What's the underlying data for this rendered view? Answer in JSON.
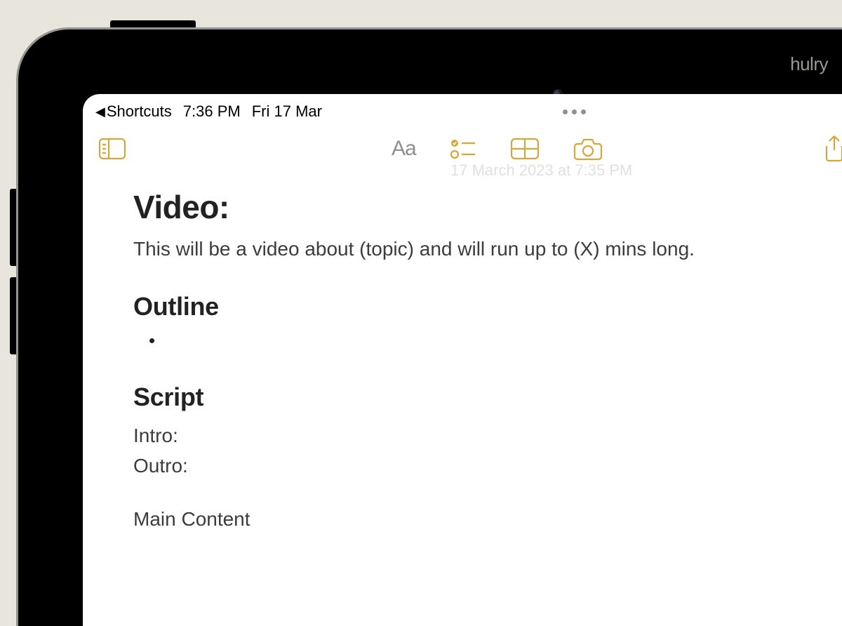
{
  "watermark": "hulry",
  "status": {
    "back_app": "Shortcuts",
    "time": "7:36 PM",
    "date": "Fri 17 Mar"
  },
  "toolbar": {
    "sidebar_label": "Sidebar",
    "text_style_label": "Aa",
    "checklist_label": "Checklist",
    "table_label": "Table",
    "camera_label": "Camera",
    "share_label": "Share"
  },
  "note": {
    "timestamp": "17 March 2023 at 7:35 PM",
    "title": "Video:",
    "subtitle": "This will be a video about (topic) and will run up to (X) mins long.",
    "sections": {
      "outline_heading": "Outline",
      "bullet_item": "",
      "script_heading": "Script",
      "script_intro": "Intro:",
      "script_outro": "Outro:",
      "main_content_heading": "Main Content"
    }
  }
}
